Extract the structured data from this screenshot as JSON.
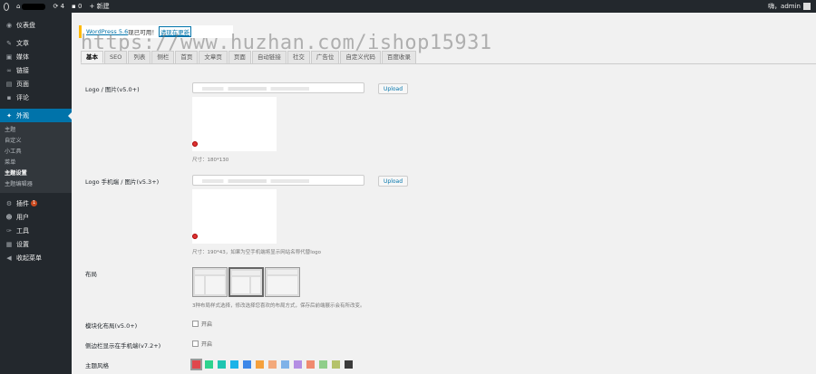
{
  "adminbar": {
    "comments_count": "4",
    "updates_count": "0",
    "new_label": "新建",
    "howdy": "嗨，admin"
  },
  "sidebar": {
    "items": [
      {
        "icon": "dashboard-icon",
        "glyph": "◉",
        "label": "仪表盘"
      },
      {
        "icon": "pin-icon",
        "glyph": "✎",
        "label": "文章"
      },
      {
        "icon": "media-icon",
        "glyph": "▣",
        "label": "媒体"
      },
      {
        "icon": "link-icon",
        "glyph": "∞",
        "label": "链接"
      },
      {
        "icon": "page-icon",
        "glyph": "▤",
        "label": "页面"
      },
      {
        "icon": "comment-icon",
        "glyph": "▪",
        "label": "评论"
      },
      {
        "icon": "appearance-icon",
        "glyph": "✦",
        "label": "外观"
      }
    ],
    "submenu": [
      "主题",
      "自定义",
      "小工具",
      "菜单",
      "主题设置",
      "主题编辑器"
    ],
    "items_after": [
      {
        "icon": "plugin-icon",
        "glyph": "⚙",
        "label": "插件",
        "badge": "1"
      },
      {
        "icon": "users-icon",
        "glyph": "☻",
        "label": "用户"
      },
      {
        "icon": "tools-icon",
        "glyph": "✑",
        "label": "工具"
      },
      {
        "icon": "settings-icon",
        "glyph": "▦",
        "label": "设置"
      },
      {
        "icon": "collapse-icon",
        "glyph": "◀",
        "label": "收起菜单"
      }
    ]
  },
  "notice": {
    "text_before": "WordPress 5.6",
    "text_middle": "现已可用！",
    "link": "请现在更新"
  },
  "watermark": "https://www.huzhan.com/ishop15931",
  "tabs": [
    "基本",
    "SEO",
    "列表",
    "侧栏",
    "首页",
    "文章页",
    "页面",
    "自动链接",
    "社交",
    "广告位",
    "自定义代码",
    "百度收录"
  ],
  "form": {
    "logo_label": "Logo / 图片(v5.0+)",
    "upload_label": "Upload",
    "logo_hint": "尺寸：180*130",
    "mobile_logo_label": "Logo 手机端 / 图片(v5.3+)",
    "mobile_logo_hint": "尺寸：190*43，如果为空手机端将显示网站名称代替logo",
    "layout_label": "布局",
    "layout_hint": "3种布局样式选择，修改选择您喜欢的布局方式，保存后前端展示会有所改变。",
    "modular_label": "模块化布局(v5.0+)",
    "modular_option": "开启",
    "sidebar_mobile_label": "侧边栏显示在手机端(v7.2+)",
    "sidebar_mobile_option": "开启",
    "theme_style_label": "主题风格"
  },
  "swatches": [
    "#e0474c",
    "#2ed38e",
    "#1fc5b1",
    "#1ab3e8",
    "#3d87e8",
    "#f5a03c",
    "#f3a97b",
    "#7fb2e8",
    "#b48ee3",
    "#f08a6f",
    "#8fce8a",
    "#b5c26a",
    "#3b3b3b"
  ]
}
